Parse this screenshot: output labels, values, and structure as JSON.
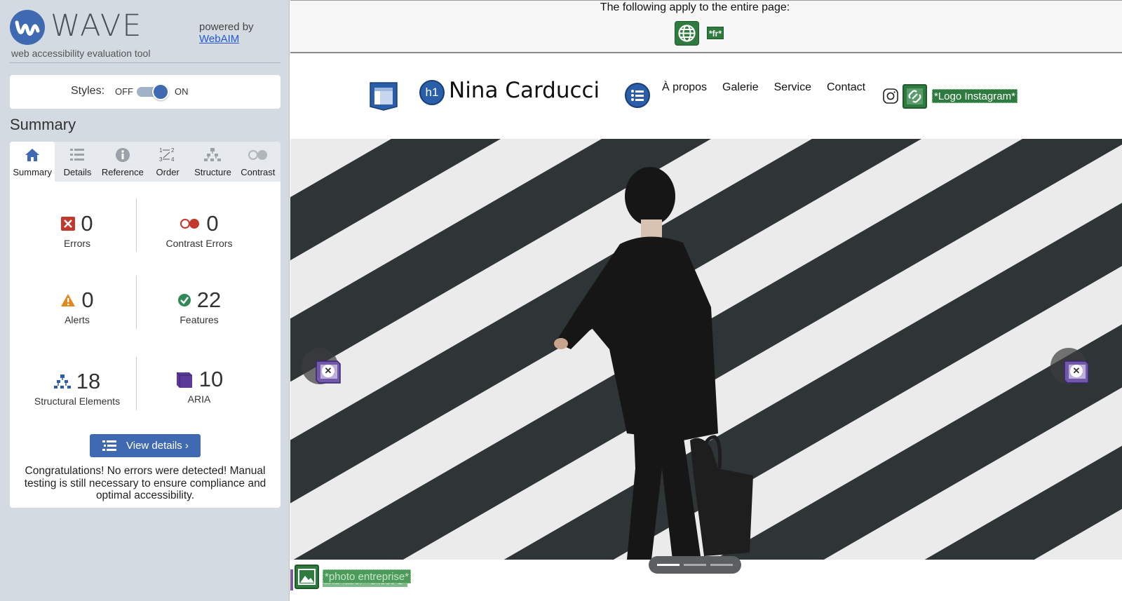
{
  "sidebar": {
    "brand": {
      "name": "WAVE",
      "subtitle": "web accessibility evaluation tool",
      "powered_by": "powered by",
      "powered_link": "WebAIM"
    },
    "styles": {
      "label": "Styles:",
      "off": "OFF",
      "on": "ON",
      "enabled": true
    },
    "summary_title": "Summary",
    "tabs": [
      {
        "label": "Summary",
        "icon": "home-icon",
        "active": true
      },
      {
        "label": "Details",
        "icon": "list-icon",
        "active": false
      },
      {
        "label": "Reference",
        "icon": "info-icon",
        "active": false
      },
      {
        "label": "Order",
        "icon": "order-icon",
        "active": false
      },
      {
        "label": "Structure",
        "icon": "structure-icon",
        "active": false
      },
      {
        "label": "Contrast",
        "icon": "contrast-icon",
        "active": false
      }
    ],
    "stats": {
      "errors": {
        "value": "0",
        "label": "Errors"
      },
      "contrast_errors": {
        "value": "0",
        "label": "Contrast Errors"
      },
      "alerts": {
        "value": "0",
        "label": "Alerts"
      },
      "features": {
        "value": "22",
        "label": "Features"
      },
      "structural": {
        "value": "18",
        "label": "Structural Elements"
      },
      "aria": {
        "value": "10",
        "label": "ARIA"
      }
    },
    "view_details": "View details ›",
    "congrats": "Congratulations! No errors were detected! Manual testing is still necessary to ensure compliance and optimal accessibility."
  },
  "preview": {
    "banner_text": "The following apply to the entire page:",
    "lang_tag": "*fr*",
    "site_name": "Nina Carducci",
    "h1_badge": "h1",
    "nav": [
      "À propos",
      "Galerie",
      "Service",
      "Contact"
    ],
    "instagram_alt": "*Logo Instagram*",
    "bottom_alt": "*photo entreprise*",
    "bottom_alt2": "aria-label=\"Slides 1\"",
    "carousel_active_slide": 1,
    "carousel_slide_count": 3
  },
  "colors": {
    "wave_blue": "#3f6ab2",
    "error_red": "#c0392b",
    "alert_orange": "#e08a1e",
    "feature_green": "#2f8a57",
    "structure_blue": "#2b5ea8",
    "aria_purple": "#5b3a99",
    "alt_green": "#2f7a3f"
  }
}
